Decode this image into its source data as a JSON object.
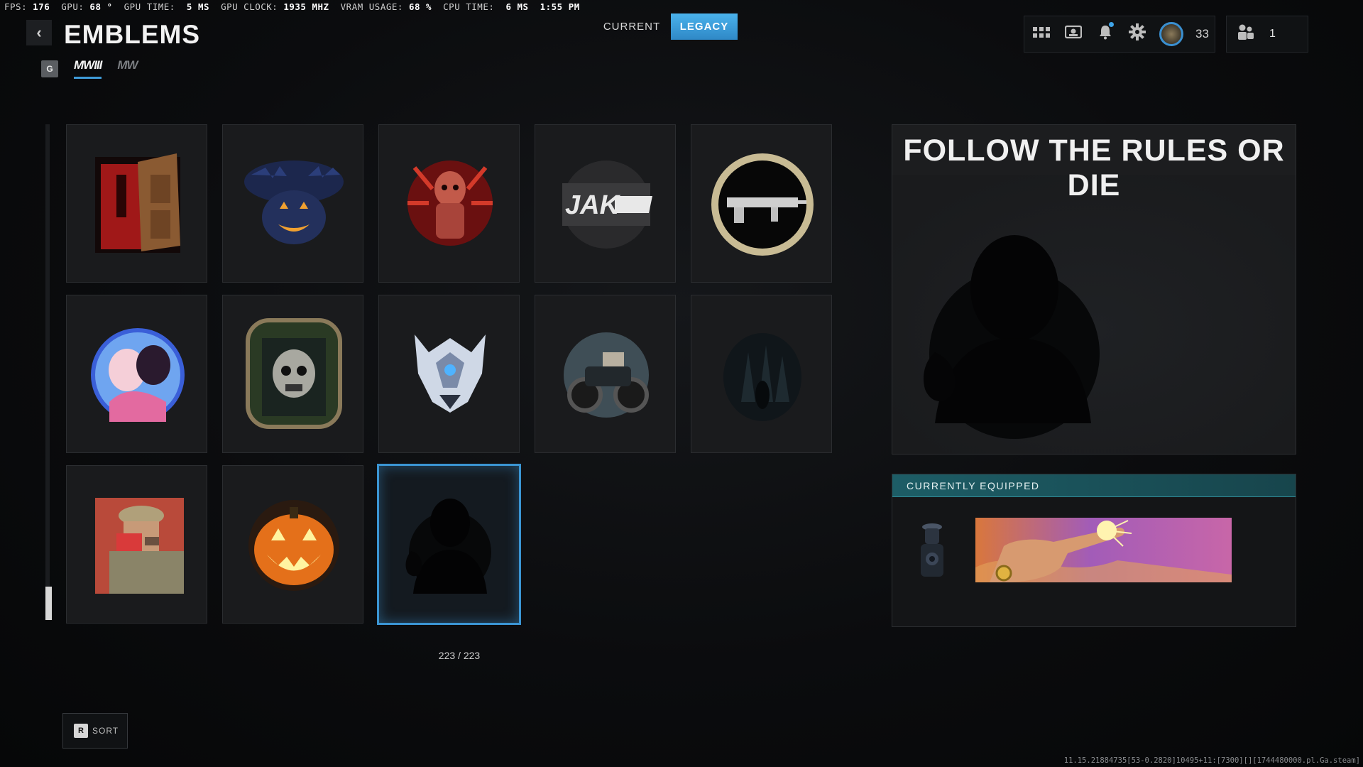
{
  "perf_overlay": {
    "fps_label": "FPS:",
    "fps": "176",
    "gpu_label": "GPU:",
    "gpu": "68 °",
    "gpu_time_label": "GPU TIME:",
    "gpu_time": "5 MS",
    "gpu_clock_label": "GPU CLOCK:",
    "gpu_clock": "1935 MHZ",
    "vram_label": "VRAM USAGE:",
    "vram": "68 %",
    "cpu_time_label": "CPU TIME:",
    "cpu_time": "6 MS",
    "clock": "1:55 PM"
  },
  "header": {
    "back_icon": "chevron-left-icon",
    "title": "EMBLEMS",
    "game_filter": {
      "all_badge": "G",
      "tabs": [
        "MWIII",
        "MW"
      ],
      "active": "MWIII"
    },
    "mode_tabs": {
      "current": "CURRENT",
      "legacy": "LEGACY",
      "active": "LEGACY"
    }
  },
  "topbar": {
    "icons": [
      "grid-icon",
      "id-card-icon",
      "bell-icon",
      "gear-icon"
    ],
    "notification_dot": true,
    "player_level": "33",
    "party_icon": "party-icon",
    "party_count": "1"
  },
  "grid": {
    "emblems": [
      {
        "name": "door-emblem",
        "art": "door"
      },
      {
        "name": "bat-pumpkin-emblem",
        "art": "bat-pumpkin"
      },
      {
        "name": "red-monster-emblem",
        "art": "red-monster"
      },
      {
        "name": "jak-arms-emblem",
        "art": "jak",
        "text": "JAK"
      },
      {
        "name": "rifle-ring-emblem",
        "art": "rifle"
      },
      {
        "name": "anime-couple-emblem",
        "art": "anime"
      },
      {
        "name": "skull-frame-emblem",
        "art": "skull-frame"
      },
      {
        "name": "crystal-wolf-emblem",
        "art": "wolf"
      },
      {
        "name": "motorcycle-emblem",
        "art": "motorcycle"
      },
      {
        "name": "dark-forest-emblem",
        "art": "forest"
      },
      {
        "name": "soldier-book-emblem",
        "art": "soldier"
      },
      {
        "name": "jack-o-lantern-emblem",
        "art": "jack-o-lantern"
      },
      {
        "name": "silhouette-emblem",
        "art": "silhouette",
        "selected": true
      }
    ],
    "counter": "223 / 223"
  },
  "sort": {
    "key": "R",
    "label": "SORT"
  },
  "preview": {
    "title": "FOLLOW THE RULES OR DIE"
  },
  "equipped": {
    "header": "CURRENTLY EQUIPPED"
  },
  "build_info": "11.15.21884735[53-0.2820]10495+11:[7300][][1744480000.pl.Ga.steam]"
}
